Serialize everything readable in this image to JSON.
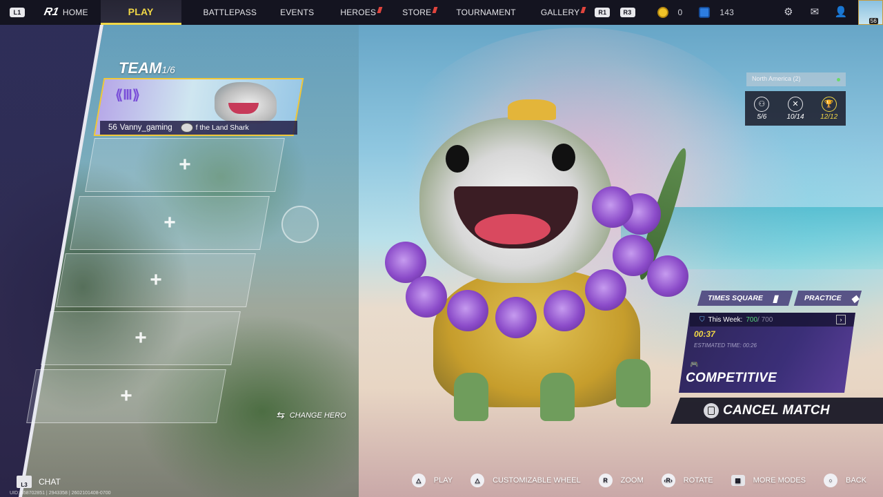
{
  "topbar": {
    "left_hint": "L1",
    "logo": "R1",
    "home": "HOME",
    "tabs": [
      {
        "label": "PLAY",
        "active": true,
        "new": false
      },
      {
        "label": "BATTLEPASS",
        "active": false,
        "new": false
      },
      {
        "label": "EVENTS",
        "active": false,
        "new": false
      },
      {
        "label": "HEROES",
        "active": false,
        "new": true
      },
      {
        "label": "STORE",
        "active": false,
        "new": true
      },
      {
        "label": "TOURNAMENT",
        "active": false,
        "new": false
      },
      {
        "label": "GALLERY",
        "active": false,
        "new": true
      }
    ],
    "right_hint": "R1",
    "r3_hint": "R3",
    "gold_amount": "0",
    "gem_amount": "143",
    "avatar_level": "56",
    "colors": {
      "active_tab": "#f2d846",
      "bar": "#141420",
      "new_flag": "#e0443d"
    }
  },
  "team": {
    "title": "TEAM",
    "count": "1/6",
    "leader": {
      "level": "56",
      "name": "Vanny_gaming",
      "hero": "f the Land Shark"
    },
    "empty_slot_icon": "+"
  },
  "change_hero": "CHANGE HERO",
  "region": "North America (2)",
  "stats": [
    {
      "icon": "team-stat-icon",
      "value": "5/6"
    },
    {
      "icon": "crossed-swords-icon",
      "value": "10/14"
    },
    {
      "icon": "trophy-icon",
      "value": "12/12"
    }
  ],
  "modes": {
    "times_square": "TIMES SQUARE",
    "practice": "PRACTICE"
  },
  "mode_card": {
    "weekly_label": "This Week:",
    "weekly_value": "700",
    "weekly_max": "/ 700",
    "timer": "00:37",
    "estimated": "ESTIMATED TIME: 00:26",
    "name": "COMPETITIVE"
  },
  "cancel_label": "CANCEL MATCH",
  "bottom": {
    "chat_hint": "L3",
    "chat": "CHAT",
    "uid": "UID: 558702851 | 2943358 | 2602101408-0700",
    "hints": [
      {
        "button": "△",
        "label": "PLAY"
      },
      {
        "button": "△",
        "label": "CUSTOMIZABLE WHEEL"
      },
      {
        "button": "R",
        "label": "ZOOM"
      },
      {
        "button": "‹R›",
        "label": "ROTATE"
      },
      {
        "button": "▦",
        "label": "MORE MODES"
      },
      {
        "button": "○",
        "label": "BACK"
      }
    ]
  }
}
